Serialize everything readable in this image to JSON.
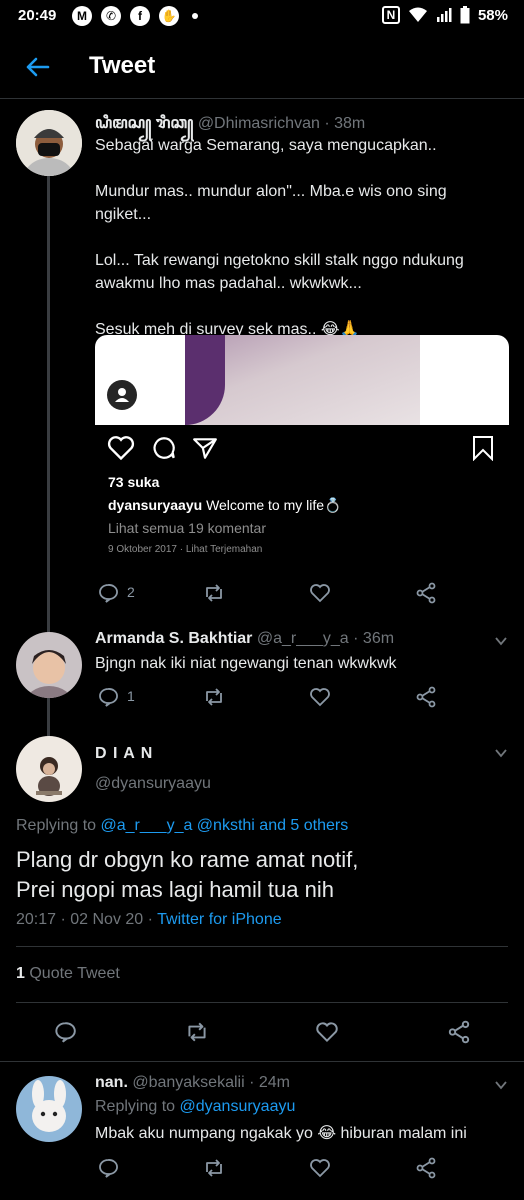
{
  "status": {
    "time": "20:49",
    "battery": "58%"
  },
  "header": {
    "title": "Tweet"
  },
  "tweet1": {
    "display_name": "ꦝꦶꦩꦱ꧀ ꦫꦶꦕ꧀",
    "handle": "@Dhimasrichvan",
    "time": "· 38m",
    "text": "Sebagai warga Semarang, saya mengucapkan..\n\nMundur mas.. mundur alon\"... Mba.e wis ono sing ngiket...\n\nLol... Tak rewangi ngetokno skill stalk nggo ndukung awakmu lho mas padahal.. wkwkwk...\n\nSesuk meh di survey sek mas.. 😂🙏",
    "embed": {
      "likes": "73 suka",
      "caption_user": "dyansuryaayu",
      "caption_text": "Welcome to my life💍",
      "comments": "Lihat semua 19 komentar",
      "date": "9 Oktober 2017",
      "translate": "· Lihat Terjemahan"
    },
    "reply_count": "2"
  },
  "tweet2": {
    "display_name": "Armanda S. Bakhtiar",
    "handle": "@a_r___y_a",
    "time": "· 36m",
    "text": "Bjngn nak iki niat ngewangi tenan wkwkwk",
    "reply_count": "1"
  },
  "main": {
    "display_name": "D I A N",
    "handle": "@dyansuryaayu",
    "replying_prefix": "Replying to",
    "replying_to": "@a_r___y_a @nksthi and 5 others",
    "text": "Plang dr obgyn ko rame amat notif,\nPrei ngopi mas lagi hamil tua nih",
    "datetime": "20:17 · 02 Nov 20 ·",
    "source": "Twitter for iPhone",
    "quote_count": "1",
    "quote_label": "Quote Tweet"
  },
  "tweet3": {
    "display_name": "nan.",
    "handle": "@banyaksekalii",
    "time": "· 24m",
    "replying_prefix": "Replying to",
    "replying_to": "@dyansuryaayu",
    "text": "Mbak aku numpang ngakak yo 😂 hiburan malam ini"
  },
  "colors": {
    "accent": "#1d9bf0",
    "background": "#000000",
    "divider": "#2f3336"
  }
}
